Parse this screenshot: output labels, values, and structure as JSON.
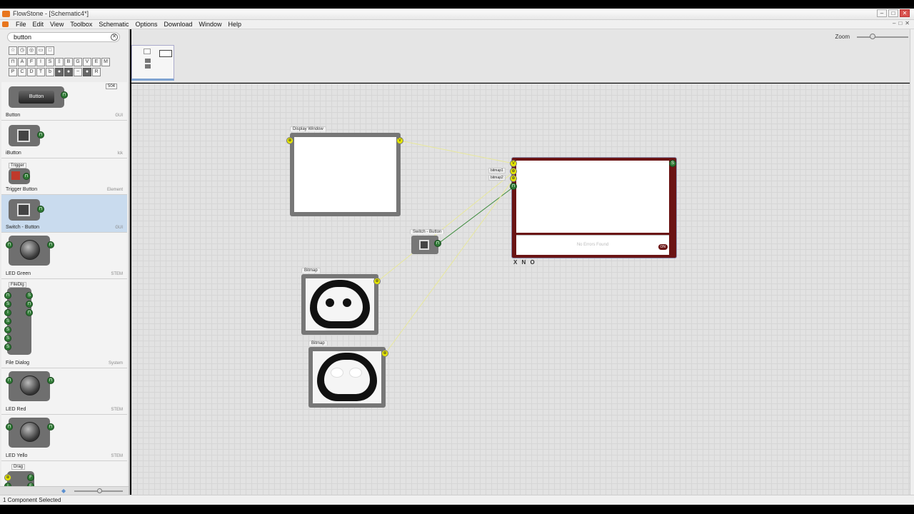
{
  "window": {
    "title": "FlowStone - [Schematic4*]",
    "controls": [
      "–",
      "□",
      "✕"
    ]
  },
  "menu": {
    "items": [
      "File",
      "Edit",
      "View",
      "Toolbox",
      "Schematic",
      "Options",
      "Download",
      "Window",
      "Help"
    ],
    "right": [
      "–",
      "□",
      "✕"
    ]
  },
  "toolbox": {
    "search_value": "button",
    "count_badge": "504",
    "components": [
      {
        "name": "Button",
        "category": "GUI",
        "label": "Button"
      },
      {
        "name": "iButton",
        "category": "Ick"
      },
      {
        "name": "Trigger Button",
        "category": "Element",
        "label": "Trigger"
      },
      {
        "name": "Switch - Button",
        "category": "GUI"
      },
      {
        "name": "LED Green",
        "category": "STEM"
      },
      {
        "name": "File Dialog",
        "category": "System",
        "label": "FileDlg"
      },
      {
        "name": "LED Red",
        "category": "STEM"
      },
      {
        "name": "LED Yello",
        "category": "STEM"
      },
      {
        "name": "",
        "category": "",
        "label": "Drag"
      }
    ]
  },
  "topbar": {
    "zoom_label": "Zoom"
  },
  "schematic": {
    "modules": [
      {
        "label": "Display Window"
      },
      {
        "label": "Switch - Button"
      },
      {
        "label": "Bitmap"
      },
      {
        "label": "Bitmap"
      }
    ],
    "ruby": {
      "inputs": [
        "bitmap1",
        "bitmap2"
      ],
      "error_text": "No Errors Found",
      "on_label": "ON",
      "footer": "X N O"
    }
  },
  "status": {
    "text": "1 Component Selected"
  },
  "colors": {
    "pin_green": "#2f7a35",
    "pin_yellow": "#e4e400",
    "ruby_border": "#6b1414",
    "accent_blue": "#7fa3d1"
  }
}
